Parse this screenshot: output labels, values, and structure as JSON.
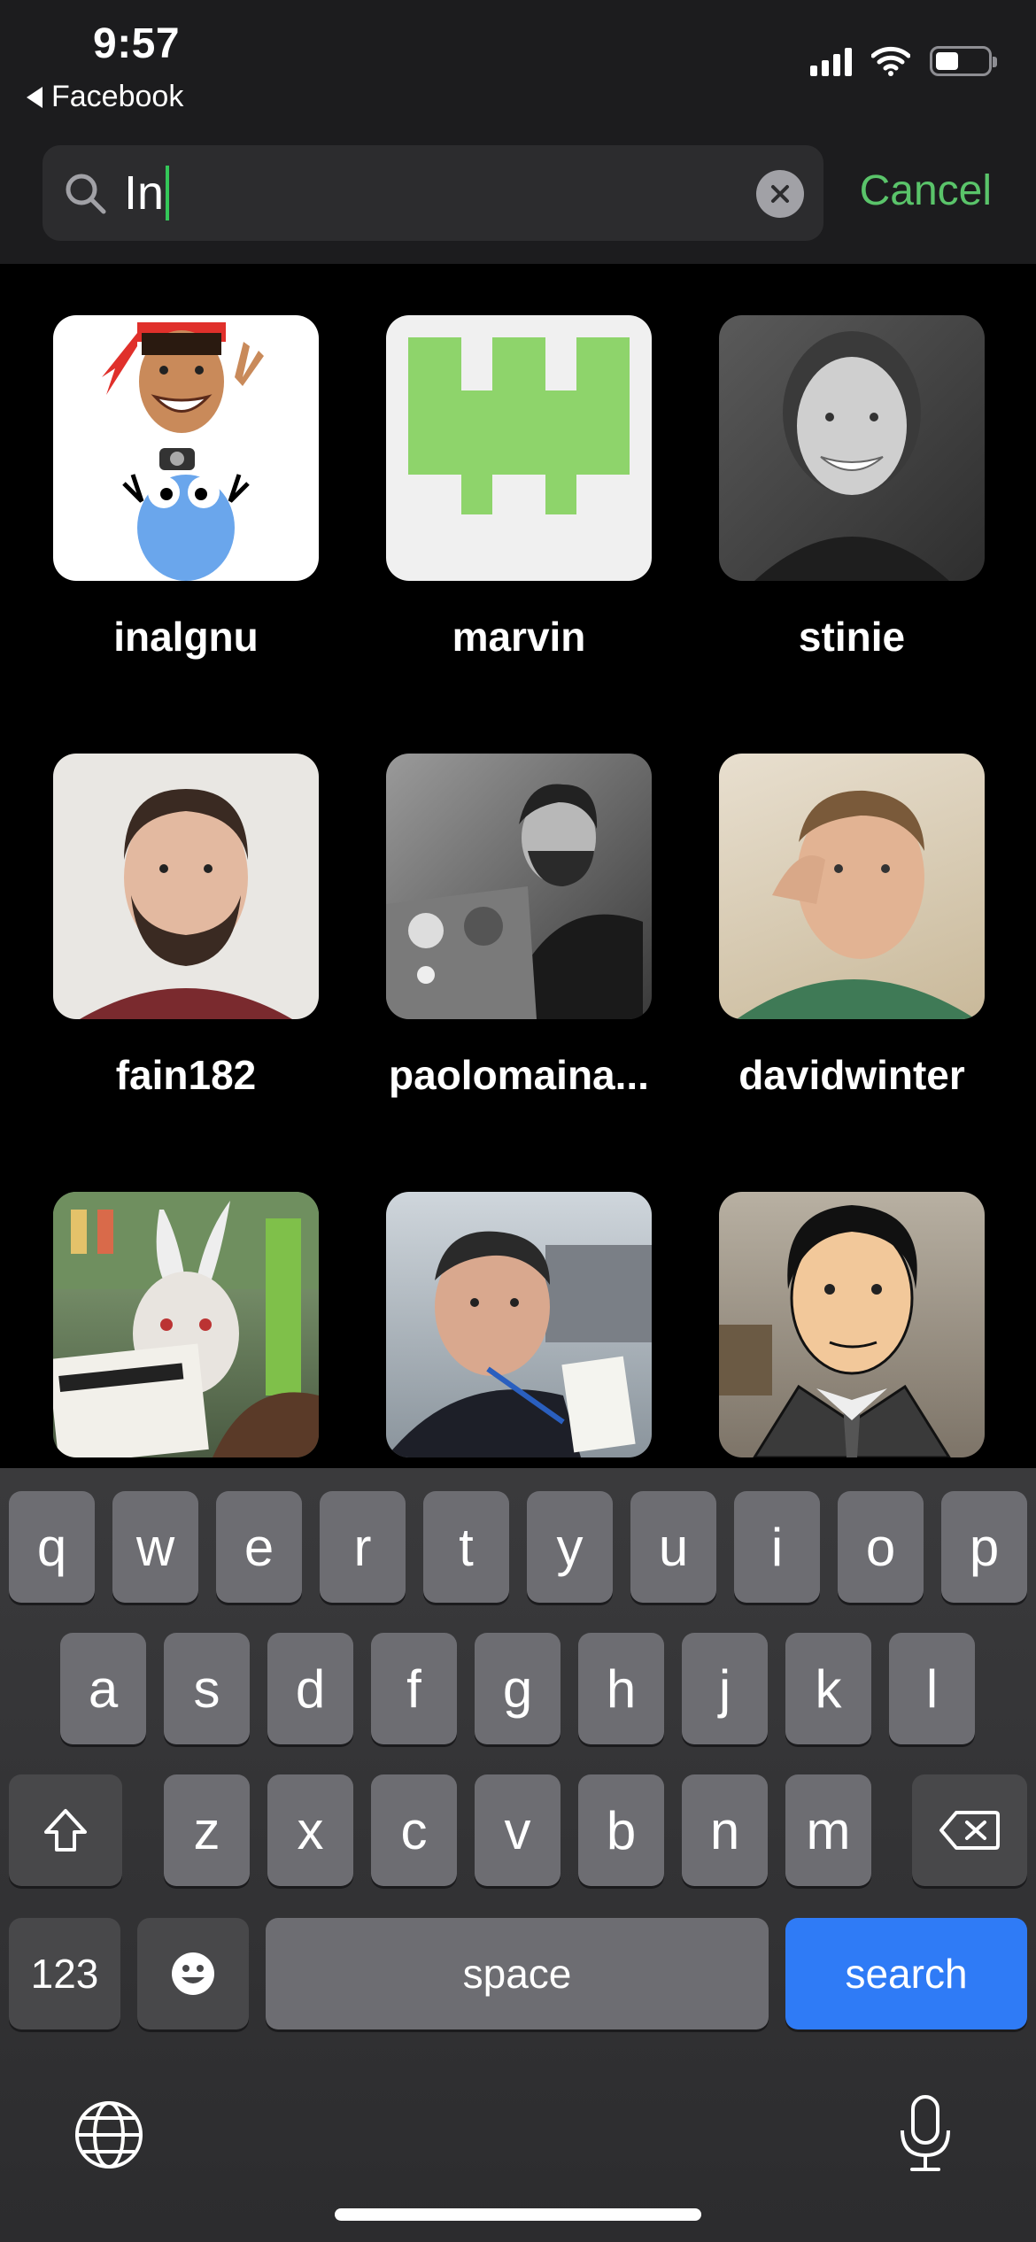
{
  "status_bar": {
    "time": "9:57",
    "back_app": "Facebook"
  },
  "search": {
    "query": "In",
    "cancel_label": "Cancel",
    "accent_color": "#5ac46a"
  },
  "results": [
    {
      "name": "inalgnu",
      "avatar": "cartoon-gopher"
    },
    {
      "name": "marvin",
      "avatar": "green-castle-logo"
    },
    {
      "name": "stinie",
      "avatar": "photo-woman-bw"
    },
    {
      "name": "fain182",
      "avatar": "photo-man-beard"
    },
    {
      "name": "paolomaina...",
      "avatar": "photo-man-laptop-bw"
    },
    {
      "name": "davidwinter",
      "avatar": "photo-man-selfie"
    },
    {
      "name": "",
      "avatar": "photo-rabbit-mask"
    },
    {
      "name": "",
      "avatar": "photo-man-badge"
    },
    {
      "name": "",
      "avatar": "cartoon-archer"
    }
  ],
  "keyboard": {
    "row1": [
      "q",
      "w",
      "e",
      "r",
      "t",
      "y",
      "u",
      "i",
      "o",
      "p"
    ],
    "row2": [
      "a",
      "s",
      "d",
      "f",
      "g",
      "h",
      "j",
      "k",
      "l"
    ],
    "row3": [
      "z",
      "x",
      "c",
      "v",
      "b",
      "n",
      "m"
    ],
    "numbers_label": "123",
    "space_label": "space",
    "search_label": "search"
  }
}
